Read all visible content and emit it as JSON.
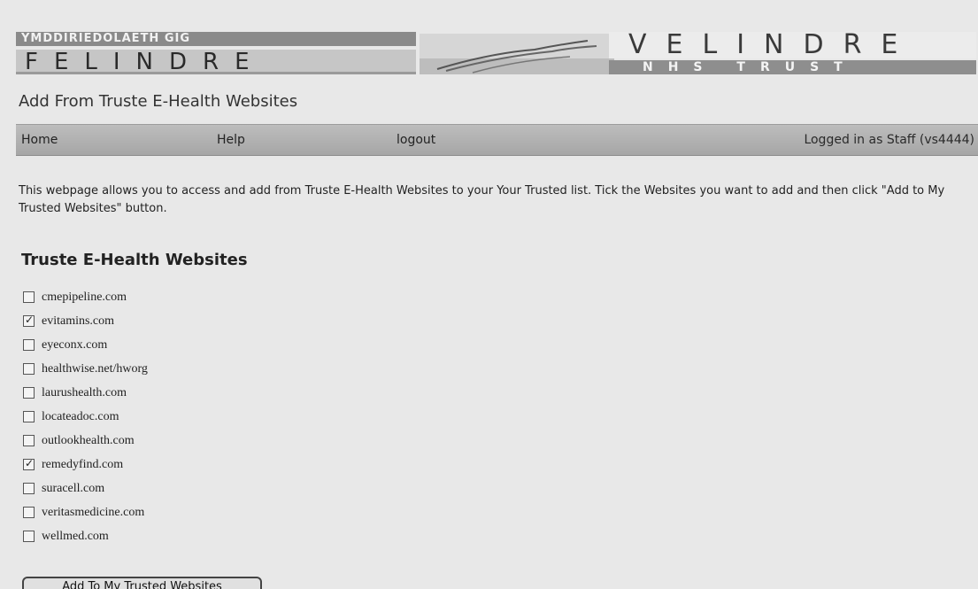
{
  "banner": {
    "welsh_name": "YMDDIRIEDOLAETH GIG",
    "org_name": "FELINDRE",
    "org_name_right": "VELINDRE",
    "trust_label": "NHS TRUST"
  },
  "page_title": "Add From Truste E-Health Websites",
  "nav": {
    "home": "Home",
    "help": "Help",
    "logout": "logout",
    "logged_in": "Logged in as Staff (vs4444)"
  },
  "intro": "This webpage allows you to access and add from Truste E-Health Websites to your Your Trusted list. Tick the Websites you want to add and then click \"Add to My Trusted Websites\" button.",
  "section_title": "Truste E-Health Websites",
  "websites": [
    {
      "label": "cmepipeline.com",
      "checked": false
    },
    {
      "label": "evitamins.com",
      "checked": true
    },
    {
      "label": "eyeconx.com",
      "checked": false
    },
    {
      "label": "healthwise.net/hworg",
      "checked": false
    },
    {
      "label": "laurushealth.com",
      "checked": false
    },
    {
      "label": "locateadoc.com",
      "checked": false
    },
    {
      "label": "outlookhealth.com",
      "checked": false
    },
    {
      "label": "remedyfind.com",
      "checked": true
    },
    {
      "label": "suracell.com",
      "checked": false
    },
    {
      "label": "veritasmedicine.com",
      "checked": false
    },
    {
      "label": "wellmed.com",
      "checked": false
    }
  ],
  "add_button": "Add To My Trusted Websites"
}
